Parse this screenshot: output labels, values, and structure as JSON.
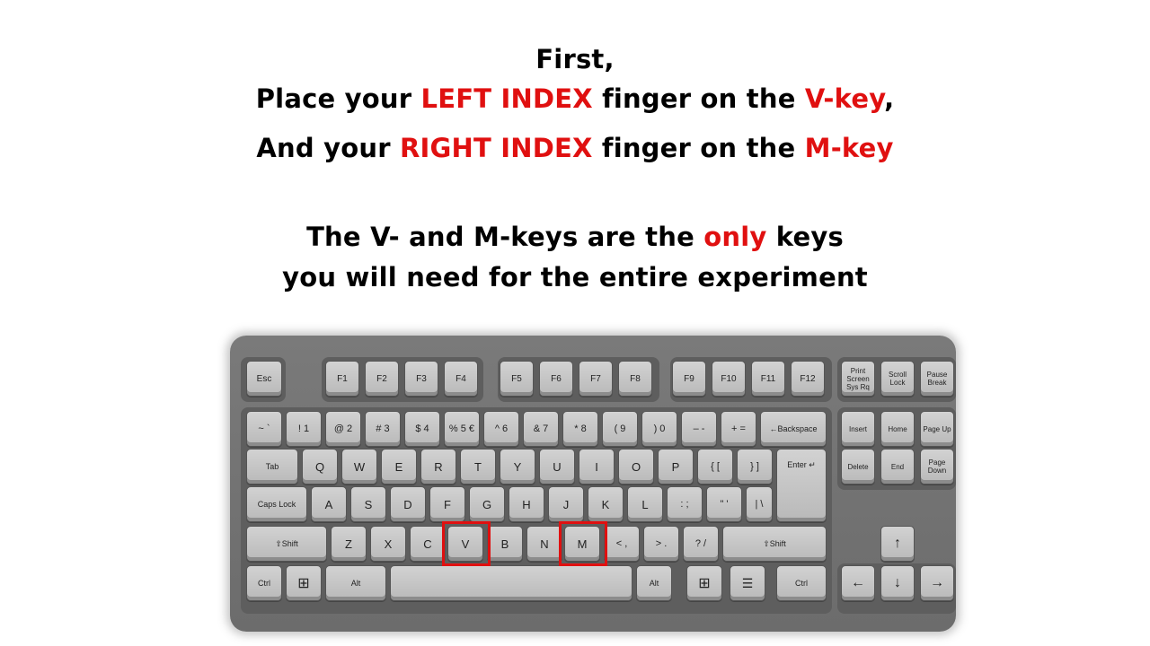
{
  "instructions": {
    "line1": "First,",
    "line2": {
      "a": "Place your ",
      "b": "LEFT INDEX",
      "c": " finger on the ",
      "d": "V-key",
      "e": ","
    },
    "line3": {
      "a": "And your ",
      "b": "RIGHT INDEX",
      "c": " finger on the ",
      "d": "M-key"
    },
    "line4": {
      "a": "The V- and M-keys are the ",
      "b": "only",
      "c": " keys"
    },
    "line5": "you will need for the entire experiment"
  },
  "colors": {
    "emphasis": "#e01010",
    "text": "#000000"
  },
  "keyboard": {
    "highlighted_keys": [
      "V",
      "M"
    ],
    "keys": {
      "esc": "Esc",
      "f1": "F1",
      "f2": "F2",
      "f3": "F3",
      "f4": "F4",
      "f5": "F5",
      "f6": "F6",
      "f7": "F7",
      "f8": "F8",
      "f9": "F9",
      "f10": "F10",
      "f11": "F11",
      "f12": "F12",
      "print": "Print Screen Sys Rq",
      "scroll": "Scroll Lock",
      "pause": "Pause Break",
      "tilde": "~ `",
      "n1": "! 1",
      "n2": "@ 2",
      "n3": "# 3",
      "n4": "$ 4",
      "n5": "% 5 €",
      "n6": "^ 6",
      "n7": "& 7",
      "n8": "* 8",
      "n9": "( 9",
      "n0": ") 0",
      "minus": "– -",
      "equals": "+ =",
      "backspace": "←Backspace",
      "insert": "Insert",
      "home": "Home",
      "pgup": "Page Up",
      "tab": "Tab",
      "q": "Q",
      "w": "W",
      "e": "E",
      "r": "R",
      "t": "T",
      "y": "Y",
      "u": "U",
      "i": "I",
      "o": "O",
      "p": "P",
      "lbracket": "{ [",
      "rbracket": "} ]",
      "enter": "Enter ↵",
      "delete": "Delete",
      "end": "End",
      "pgdn": "Page Down",
      "caps": "Caps Lock",
      "a": "A",
      "s": "S",
      "d": "D",
      "f": "F",
      "g": "G",
      "h": "H",
      "j": "J",
      "k": "K",
      "l": "L",
      "semicolon": ": ;",
      "quote": "\" '",
      "backslash": "| \\",
      "lshift": "⇧Shift",
      "z": "Z",
      "x": "X",
      "c": "C",
      "v": "V",
      "b": "B",
      "n": "N",
      "m": "M",
      "comma": "< ,",
      "period": "> .",
      "slash": "? /",
      "rshift": "⇧Shift",
      "up": "↑",
      "lctrl": "Ctrl",
      "lwin": "⊞",
      "lalt": "Alt",
      "ralt": "Alt",
      "rwin": "⊞",
      "menu": "☰",
      "rctrl": "Ctrl",
      "left": "←",
      "down": "↓",
      "right": "→"
    }
  }
}
